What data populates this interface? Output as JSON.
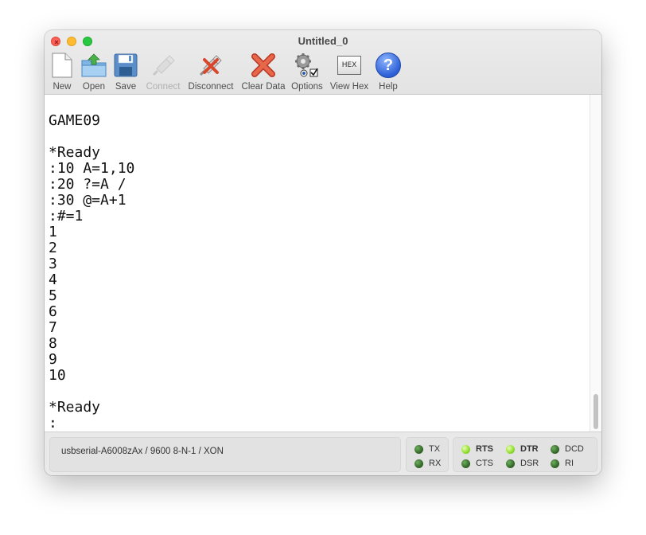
{
  "window": {
    "title": "Untitled_0"
  },
  "toolbar": {
    "new_label": "New",
    "open_label": "Open",
    "save_label": "Save",
    "connect_label": "Connect",
    "disconnect_label": "Disconnect",
    "clear_label": "Clear Data",
    "options_label": "Options",
    "viewhex_label": "View Hex",
    "viewhex_icon_text": "HEX",
    "help_label": "Help",
    "help_icon_text": "?"
  },
  "terminal": {
    "lines": [
      "GAME09",
      "",
      "*Ready",
      ":10 A=1,10",
      ":20 ?=A /",
      ":30 @=A+1",
      ":#=1",
      "1",
      "2",
      "3",
      "4",
      "5",
      "6",
      "7",
      "8",
      "9",
      "10",
      "",
      "*Ready",
      ":"
    ]
  },
  "status": {
    "port_info": "usbserial-A6008zAx / 9600 8-N-1 / XON",
    "tx": "TX",
    "rx": "RX",
    "rts": "RTS",
    "cts": "CTS",
    "dtr": "DTR",
    "dsr": "DSR",
    "dcd": "DCD",
    "ri": "RI"
  }
}
